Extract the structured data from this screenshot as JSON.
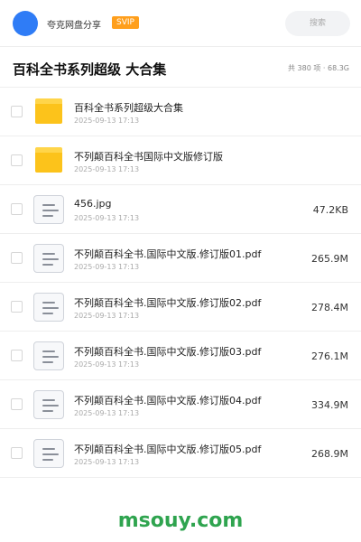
{
  "header": {
    "brand": "夸克网盘分享",
    "badge": "SVIP",
    "search_placeholder": "搜索"
  },
  "title_bar": {
    "title": "百科全书系列超级 大合集",
    "summary": "共 380 项 · 68.3G"
  },
  "files": [
    {
      "type": "folder",
      "icon": "folder-icon",
      "name": "百科全书系列超级大合集",
      "date": "2025-09-13 17:13",
      "size": ""
    },
    {
      "type": "folder",
      "icon": "folder-icon",
      "name": "不列颠百科全书国际中文版修订版",
      "date": "2025-09-13 17:13",
      "size": ""
    },
    {
      "type": "file",
      "icon": "document-icon",
      "name": "456.jpg",
      "date": "2025-09-13 17:13",
      "size": "47.2KB"
    },
    {
      "type": "file",
      "icon": "document-icon",
      "name": "不列颠百科全书.国际中文版.修订版01.pdf",
      "date": "2025-09-13 17:13",
      "size": "265.9M"
    },
    {
      "type": "file",
      "icon": "document-icon",
      "name": "不列颠百科全书.国际中文版.修订版02.pdf",
      "date": "2025-09-13 17:13",
      "size": "278.4M"
    },
    {
      "type": "file",
      "icon": "document-icon",
      "name": "不列颠百科全书.国际中文版.修订版03.pdf",
      "date": "2025-09-13 17:13",
      "size": "276.1M"
    },
    {
      "type": "file",
      "icon": "document-icon",
      "name": "不列颠百科全书.国际中文版.修订版04.pdf",
      "date": "2025-09-13 17:13",
      "size": "334.9M"
    },
    {
      "type": "file",
      "icon": "document-icon",
      "name": "不列颠百科全书.国际中文版.修订版05.pdf",
      "date": "2025-09-13 17:13",
      "size": "268.9M"
    }
  ],
  "watermark": "msouy.com",
  "colors": {
    "avatar": "#2f7cf6",
    "badge": "#ff9f1c",
    "folder": "#fcc31b",
    "watermark": "#2fa44f"
  }
}
